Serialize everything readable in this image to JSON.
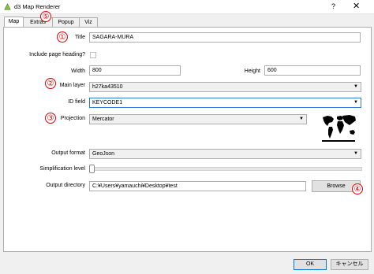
{
  "window": {
    "title": "d3 Map Renderer",
    "help_label": "?",
    "close_label": "✕"
  },
  "tabs": [
    {
      "label": "Map",
      "active": true
    },
    {
      "label": "Extras",
      "active": false
    },
    {
      "label": "Popup",
      "active": false
    },
    {
      "label": "Viz",
      "active": false
    }
  ],
  "form": {
    "title_label": "Title",
    "title_value": "SAGARA-MURA",
    "include_heading_label": "Include page heading?",
    "include_heading_checked": false,
    "width_label": "Width",
    "width_value": "800",
    "height_label": "Height",
    "height_value": "600",
    "main_layer_label": "Main layer",
    "main_layer_value": "h27ka43510",
    "id_field_label": "ID field",
    "id_field_value": "KEYCODE1",
    "projection_label": "Projection",
    "projection_value": "Mercator",
    "output_format_label": "Output format",
    "output_format_value": "GeoJson",
    "simplification_label": "Simplification level",
    "simplification_value": 0,
    "output_dir_label": "Output directory",
    "output_dir_value": "C:¥Users¥yamauchi¥Desktop¥test",
    "browse_label": "Browse"
  },
  "annotations": [
    "①",
    "②",
    "③",
    "④",
    "⑤"
  ],
  "footer": {
    "ok_label": "OK",
    "cancel_label": "キャンセル"
  },
  "colors": {
    "annotation_red": "#e00000",
    "focus_blue": "#2f78d4"
  }
}
